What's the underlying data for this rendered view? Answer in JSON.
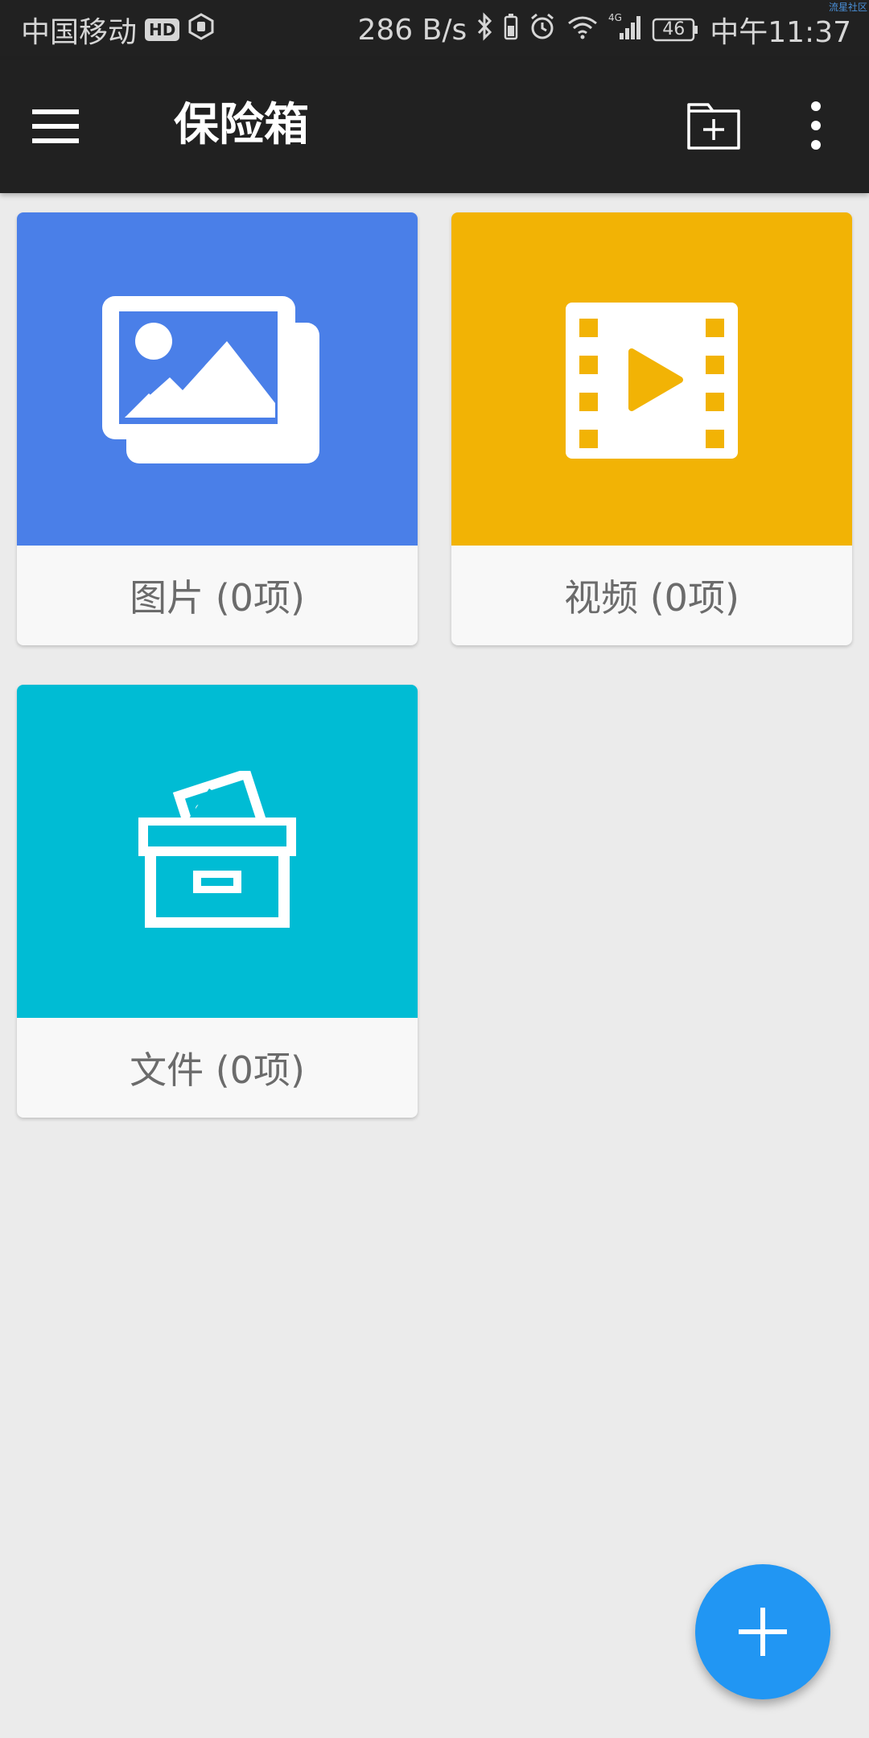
{
  "status_bar": {
    "carrier": "中国移动",
    "hd_badge": "HD",
    "net_speed": "286 B/s",
    "network_type": "4G",
    "battery_level": "46",
    "time": "中午11:37",
    "watermark": "流星社区"
  },
  "app_bar": {
    "title": "保险箱",
    "icons": [
      "menu-icon",
      "new-folder-icon",
      "more-vert-icon"
    ]
  },
  "categories": [
    {
      "label": "图片 (0项)",
      "color": "#4a7fe8",
      "icon": "photo-icon"
    },
    {
      "label": "视频 (0项)",
      "color": "#f2b305",
      "icon": "video-film-icon"
    },
    {
      "label": "文件 (0项)",
      "color": "#00bcd4",
      "icon": "file-box-icon"
    }
  ],
  "fab": {
    "icon": "plus-icon",
    "color": "#2196f3"
  }
}
